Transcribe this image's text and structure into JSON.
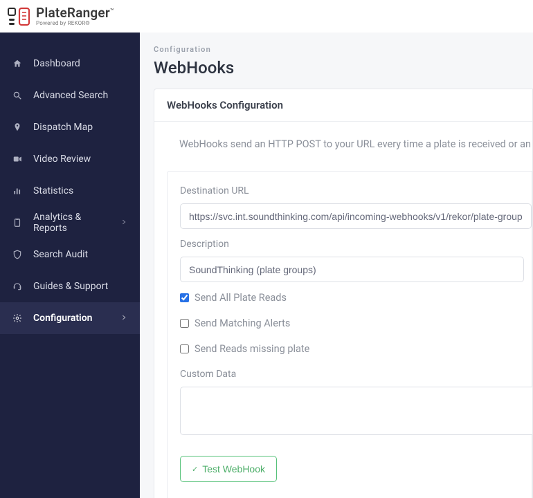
{
  "brand": {
    "main": "PlateRanger",
    "tm": "™",
    "sub": "Powered by REKOR®"
  },
  "sidebar": {
    "items": [
      {
        "label": "Dashboard",
        "icon": "home"
      },
      {
        "label": "Advanced Search",
        "icon": "search"
      },
      {
        "label": "Dispatch Map",
        "icon": "pin"
      },
      {
        "label": "Video Review",
        "icon": "video"
      },
      {
        "label": "Statistics",
        "icon": "bar"
      },
      {
        "label": "Analytics & Reports",
        "icon": "clipboard",
        "chevron": true
      },
      {
        "label": "Search Audit",
        "icon": "shield"
      },
      {
        "label": "Guides & Support",
        "icon": "headset"
      },
      {
        "label": "Configuration",
        "icon": "gear",
        "chevron": true,
        "active": true
      }
    ]
  },
  "page": {
    "crumb": "Configuration",
    "title": "WebHooks",
    "card_title": "WebHooks Configuration",
    "helper": "WebHooks send an HTTP POST to your URL every time a plate is received or an alert is "
  },
  "form": {
    "url_label": "Destination URL",
    "url_value": "https://svc.int.soundthinking.com/api/incoming-webhooks/v1/rekor/plate-group?apiKey=",
    "desc_label": "Description",
    "desc_value": "SoundThinking (plate groups)",
    "chk_all": "Send All Plate Reads",
    "chk_alerts": "Send Matching Alerts",
    "chk_missing": "Send Reads missing plate",
    "custom_label": "Custom Data",
    "custom_value": "",
    "test_label": "Test WebHook",
    "checks": {
      "all": true,
      "alerts": false,
      "missing": false
    }
  }
}
